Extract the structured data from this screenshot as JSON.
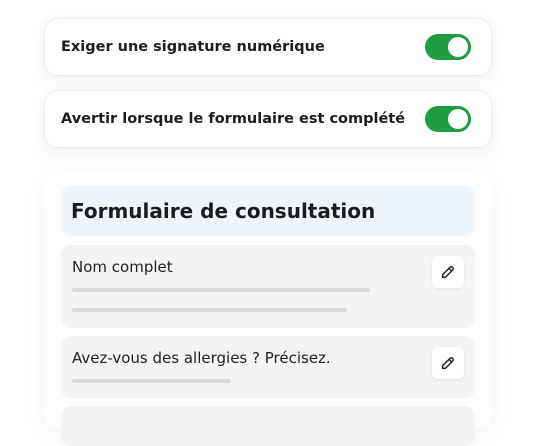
{
  "settings": [
    {
      "label": "Exiger une signature numérique",
      "enabled": true
    },
    {
      "label": "Avertir lorsque le formulaire est complété",
      "enabled": true
    }
  ],
  "form": {
    "title": "Formulaire de consultation",
    "fields": [
      {
        "label": "Nom complet"
      },
      {
        "label": "Avez-vous des allergies ? Précisez."
      },
      {
        "label": ""
      }
    ]
  },
  "colors": {
    "toggle_on": "#1f9d43",
    "header_bg": "#eef5fd",
    "field_bg": "#f4f4f4"
  },
  "icons": {
    "edit": "pencil-icon"
  }
}
